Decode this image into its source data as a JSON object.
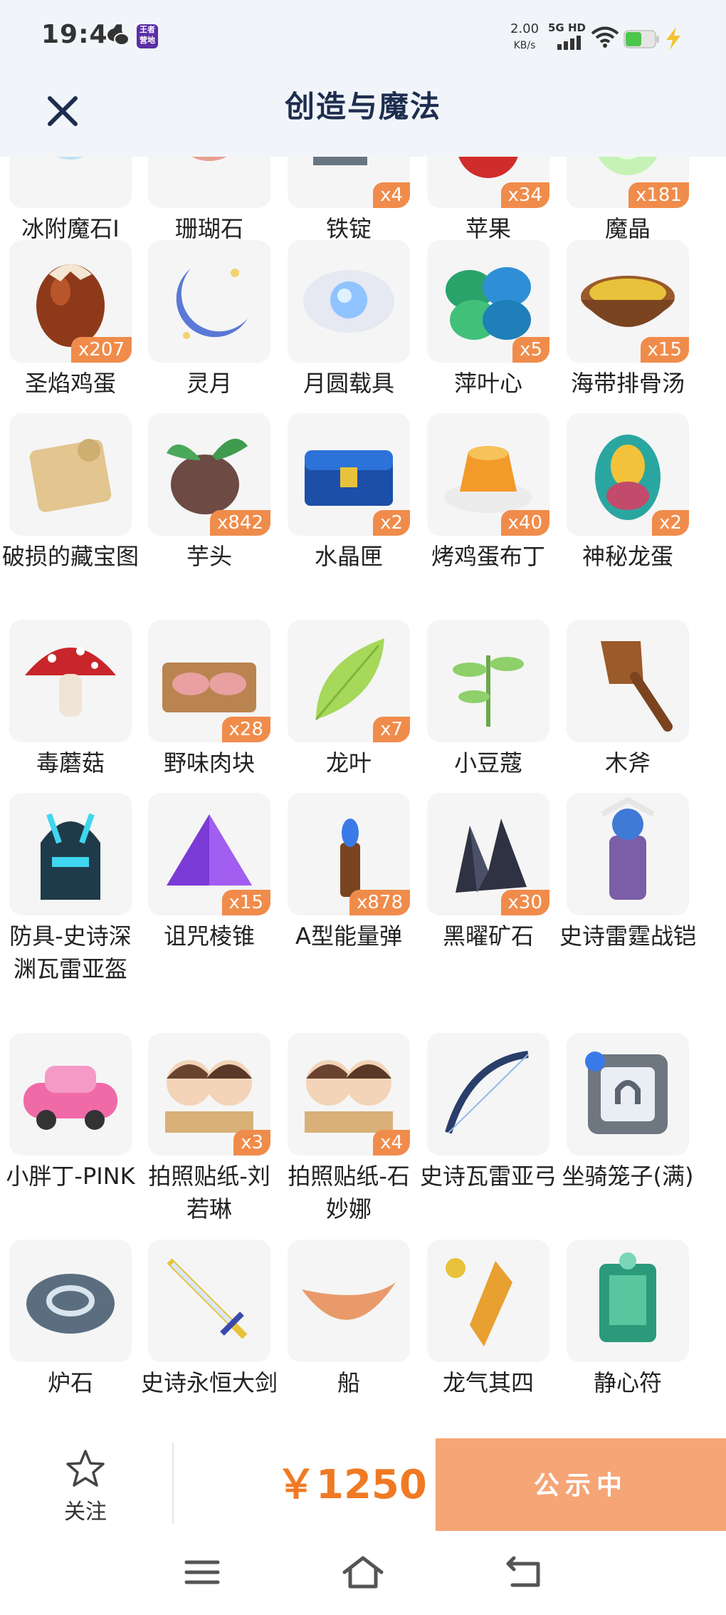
{
  "status_bar": {
    "time": "19:44",
    "app_badge": "王者营地",
    "speed_value": "2.00",
    "speed_unit": "KB/s",
    "network": "5G HD",
    "icons": [
      "wechat-icon",
      "app-icon",
      "signal-icon",
      "wifi-icon",
      "battery-icon",
      "charging-icon"
    ]
  },
  "header": {
    "title": "创造与魔法",
    "close_icon": "close-icon"
  },
  "items": [
    {
      "name": "冰附魔石I",
      "qty": "",
      "icon": "frost-stone"
    },
    {
      "name": "珊瑚石",
      "qty": "",
      "icon": "coral-stone"
    },
    {
      "name": "铁锭",
      "qty": "x4",
      "icon": "iron-ingot"
    },
    {
      "name": "苹果",
      "qty": "x34",
      "icon": "apple"
    },
    {
      "name": "魔晶",
      "qty": "x181",
      "icon": "magic-crystal"
    },
    {
      "name": "圣焰鸡蛋",
      "qty": "x207",
      "icon": "egg"
    },
    {
      "name": "灵月",
      "qty": "",
      "icon": "moon"
    },
    {
      "name": "月圆载具",
      "qty": "",
      "icon": "moon-orb"
    },
    {
      "name": "萍叶心",
      "qty": "x5",
      "icon": "leaf-clover"
    },
    {
      "name": "海带排骨汤",
      "qty": "x15",
      "icon": "soup"
    },
    {
      "name": "破损的藏宝图",
      "qty": "",
      "icon": "treasure-map"
    },
    {
      "name": "芋头",
      "qty": "x842",
      "icon": "taro"
    },
    {
      "name": "水晶匣",
      "qty": "x2",
      "icon": "chest"
    },
    {
      "name": "烤鸡蛋布丁",
      "qty": "x40",
      "icon": "pudding"
    },
    {
      "name": "神秘龙蛋",
      "qty": "x2",
      "icon": "dragon-egg"
    },
    {
      "name": "毒蘑菇",
      "qty": "",
      "icon": "mushroom"
    },
    {
      "name": "野味肉块",
      "qty": "x28",
      "icon": "meat"
    },
    {
      "name": "龙叶",
      "qty": "x7",
      "icon": "dragon-leaf"
    },
    {
      "name": "小豆蔻",
      "qty": "",
      "icon": "cardamom"
    },
    {
      "name": "木斧",
      "qty": "",
      "icon": "wood-axe"
    },
    {
      "name": "防具-史诗深渊瓦雷亚盔",
      "qty": "",
      "icon": "helmet"
    },
    {
      "name": "诅咒棱锥",
      "qty": "x15",
      "icon": "pyramid"
    },
    {
      "name": "A型能量弹",
      "qty": "x878",
      "icon": "energy-bullet"
    },
    {
      "name": "黑曜矿石",
      "qty": "x30",
      "icon": "obsidian"
    },
    {
      "name": "史诗雷霆战铠",
      "qty": "",
      "icon": "armor"
    },
    {
      "name": "小胖丁-PINK",
      "qty": "",
      "icon": "pink-car"
    },
    {
      "name": "拍照贴纸-刘若琳",
      "qty": "x3",
      "icon": "photo-sticker"
    },
    {
      "name": "拍照贴纸-石妙娜",
      "qty": "x4",
      "icon": "photo-sticker"
    },
    {
      "name": "史诗瓦雷亚弓",
      "qty": "",
      "icon": "bow"
    },
    {
      "name": "坐骑笼子(满)",
      "qty": "",
      "icon": "mount-cage"
    },
    {
      "name": "炉石",
      "qty": "",
      "icon": "hearthstone"
    },
    {
      "name": "史诗永恒大剑",
      "qty": "",
      "icon": "great-sword"
    },
    {
      "name": "船",
      "qty": "",
      "icon": "boat"
    },
    {
      "name": "龙气其四",
      "qty": "",
      "icon": "dragon-qi"
    },
    {
      "name": "静心符",
      "qty": "",
      "icon": "talisman"
    }
  ],
  "action_bar": {
    "follow_label": "关注",
    "price": "￥1250",
    "status_button": "公示中",
    "price_color": "#f07a24",
    "status_color": "#f6a577"
  },
  "nav_bar": {
    "icons": [
      "menu-icon",
      "home-icon",
      "back-icon"
    ]
  },
  "colors": {
    "qty_badge": "#f08c4b",
    "header_bg": "#f1f5f9",
    "title": "#1e2d4f"
  }
}
